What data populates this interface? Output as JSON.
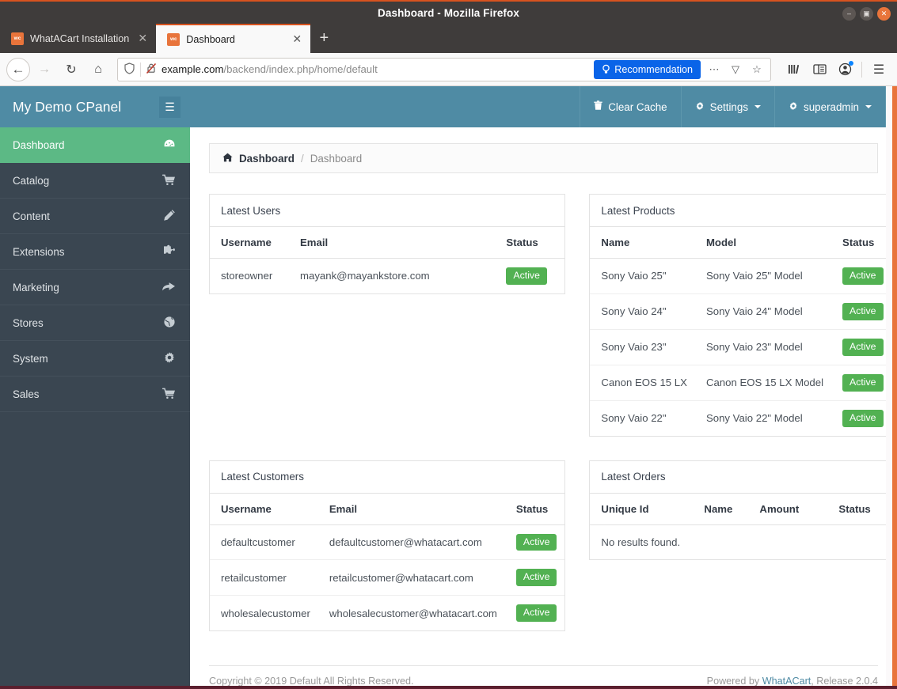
{
  "window": {
    "title": "Dashboard - Mozilla Firefox",
    "controls": {
      "minimize": "–",
      "maximize": "▣",
      "close": "✕"
    }
  },
  "browser": {
    "tabs": [
      {
        "title": "WhatACart Installation",
        "favicon": "wc",
        "close": "✕",
        "active": false
      },
      {
        "title": "Dashboard",
        "favicon": "wc",
        "close": "✕",
        "active": true
      }
    ],
    "new_tab_label": "+",
    "nav": {
      "back": "←",
      "forward": "→",
      "reload": "↻",
      "home": "⌂"
    },
    "url": {
      "domain": "example.com",
      "path": "/backend/index.php/home/default",
      "shield_icon": "shield-icon",
      "insecure_icon": "broken-lock-icon",
      "recommendation_label": "Recommendation",
      "page_actions_icon": "⋯",
      "pocket_icon": "▽",
      "bookmark_icon": "☆"
    },
    "toolbar": {
      "library": "library-icon",
      "sidebar": "sidebar-icon",
      "account": "account-icon",
      "menu": "☰"
    }
  },
  "sidebar": {
    "brand": "My Demo CPanel",
    "toggle_icon": "☰",
    "items": [
      {
        "label": "Dashboard",
        "icon": "tachometer-icon",
        "glyph": "◔",
        "active": true
      },
      {
        "label": "Catalog",
        "icon": "shopping-cart-icon",
        "glyph": "Ὥ2",
        "active": false
      },
      {
        "label": "Content",
        "icon": "pencil-icon",
        "glyph": "✎",
        "active": false
      },
      {
        "label": "Extensions",
        "icon": "puzzle-piece-icon",
        "glyph": "❖",
        "active": false
      },
      {
        "label": "Marketing",
        "icon": "share-arrow-icon",
        "glyph": "➦",
        "active": false
      },
      {
        "label": "Stores",
        "icon": "globe-icon",
        "glyph": "◕",
        "active": false
      },
      {
        "label": "System",
        "icon": "gear-icon",
        "glyph": "⚙",
        "active": false
      },
      {
        "label": "Sales",
        "icon": "shopping-cart-icon",
        "glyph": "Ὥ2",
        "active": false
      }
    ]
  },
  "topnav": {
    "clear_cache": "Clear Cache",
    "clear_cache_icon": "trash-icon",
    "settings": "Settings",
    "settings_icon": "gear-icon",
    "user": "superadmin",
    "user_icon": "gear-icon"
  },
  "breadcrumb": {
    "home_icon": "home-icon",
    "root": "Dashboard",
    "separator": "/",
    "current": "Dashboard"
  },
  "panels": {
    "latest_users": {
      "title": "Latest Users",
      "columns": [
        "Username",
        "Email",
        "Status"
      ],
      "rows": [
        {
          "username": "storeowner",
          "email": "mayank@mayankstore.com",
          "status": "Active"
        }
      ]
    },
    "latest_products": {
      "title": "Latest Products",
      "columns": [
        "Name",
        "Model",
        "Status"
      ],
      "rows": [
        {
          "name": "Sony Vaio 25\"",
          "model": "Sony Vaio 25\" Model",
          "status": "Active"
        },
        {
          "name": "Sony Vaio 24\"",
          "model": "Sony Vaio 24\" Model",
          "status": "Active"
        },
        {
          "name": "Sony Vaio 23\"",
          "model": "Sony Vaio 23\" Model",
          "status": "Active"
        },
        {
          "name": "Canon EOS 15 LX",
          "model": "Canon EOS 15 LX Model",
          "status": "Active"
        },
        {
          "name": "Sony Vaio 22\"",
          "model": "Sony Vaio 22\" Model",
          "status": "Active"
        }
      ]
    },
    "latest_customers": {
      "title": "Latest Customers",
      "columns": [
        "Username",
        "Email",
        "Status"
      ],
      "rows": [
        {
          "username": "defaultcustomer",
          "email": "defaultcustomer@whatacart.com",
          "status": "Active"
        },
        {
          "username": "retailcustomer",
          "email": "retailcustomer@whatacart.com",
          "status": "Active"
        },
        {
          "username": "wholesalecustomer",
          "email": "wholesalecustomer@whatacart.com",
          "status": "Active"
        }
      ]
    },
    "latest_orders": {
      "title": "Latest Orders",
      "columns": [
        "Unique Id",
        "Name",
        "Amount",
        "Status"
      ],
      "empty_text": "No results found."
    }
  },
  "footer": {
    "copyright": "Copyright © 2019 Default All Rights Reserved.",
    "powered_prefix": "Powered by ",
    "powered_link": "WhatACart",
    "powered_suffix": ", Release 2.0.4"
  },
  "colors": {
    "brand_blue": "#4f8ba4",
    "sidebar_dark": "#3a4651",
    "active_green": "#5cb985",
    "badge_green": "#52b152",
    "firefox_chrome": "#3f3c3b",
    "accent_orange": "#e8743b",
    "recommendation_blue": "#0a64e8"
  }
}
